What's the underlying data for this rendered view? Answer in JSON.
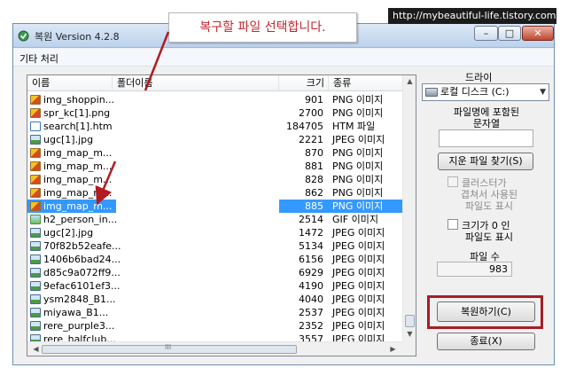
{
  "annotation": {
    "url": "http://mybeautiful-life.tistory.com",
    "callout": "복구할 파일 선택합니다."
  },
  "window": {
    "title": "복원 Version 4.2.8",
    "minimize": "–",
    "maximize": "□",
    "close": "✕"
  },
  "menu": {
    "misc": "기타 처리"
  },
  "list": {
    "headers": {
      "name": "이름",
      "folder": "폴더이름",
      "size": "크기",
      "type": "종류"
    },
    "rows": [
      {
        "name": "img_shoppin...",
        "size": "901",
        "type": "PNG 이미지",
        "icon": "png"
      },
      {
        "name": "spr_kc[1].png",
        "size": "2700",
        "type": "PNG 이미지",
        "icon": "png"
      },
      {
        "name": "search[1].htm",
        "size": "184705",
        "type": "HTM 파일",
        "icon": "htm"
      },
      {
        "name": "ugc[1].jpg",
        "size": "2221",
        "type": "JPEG 이미지",
        "icon": "jpeg"
      },
      {
        "name": "img_map_m...",
        "size": "870",
        "type": "PNG 이미지",
        "icon": "png"
      },
      {
        "name": "img_map_m...",
        "size": "881",
        "type": "PNG 이미지",
        "icon": "png"
      },
      {
        "name": "img_map_m...",
        "size": "828",
        "type": "PNG 이미지",
        "icon": "png"
      },
      {
        "name": "img_map_m...",
        "size": "862",
        "type": "PNG 이미지",
        "icon": "png"
      },
      {
        "name": "img_map_m...",
        "size": "885",
        "type": "PNG 이미지",
        "icon": "png",
        "selected": true
      },
      {
        "name": "h2_person_in...",
        "size": "2514",
        "type": "GIF 이미지",
        "icon": "gif"
      },
      {
        "name": "ugc[2].jpg",
        "size": "1472",
        "type": "JPEG 이미지",
        "icon": "jpeg"
      },
      {
        "name": "70f82b52eafe...",
        "size": "5134",
        "type": "JPEG 이미지",
        "icon": "jpeg"
      },
      {
        "name": "1406b6bad24...",
        "size": "6156",
        "type": "JPEG 이미지",
        "icon": "jpeg"
      },
      {
        "name": "d85c9a072ff9...",
        "size": "6929",
        "type": "JPEG 이미지",
        "icon": "jpeg"
      },
      {
        "name": "9efac6101ef3...",
        "size": "4190",
        "type": "JPEG 이미지",
        "icon": "jpeg"
      },
      {
        "name": "ysm2848_B1...",
        "size": "4040",
        "type": "JPEG 이미지",
        "icon": "jpeg"
      },
      {
        "name": "miyawa_B1...",
        "size": "2537",
        "type": "JPEG 이미지",
        "icon": "jpeg"
      },
      {
        "name": "rere_purple3...",
        "size": "2352",
        "type": "JPEG 이미지",
        "icon": "jpeg"
      },
      {
        "name": "rere_halfclub...",
        "size": "3557",
        "type": "JPEG 이미지",
        "icon": "jpeg"
      }
    ],
    "hscroll_grip": "III"
  },
  "panel": {
    "drive_label": "드라이",
    "drive_value": "로컬 디스크 (C:)",
    "filter_label_1": "파일명에 포함된",
    "filter_label_2": "문자열",
    "search_button": "지운 파일 찾기(S)",
    "cluster_1": "클러스터가",
    "cluster_2": "겹쳐서 사용된",
    "cluster_3": "파일도 표시",
    "zero_1": "크기가 0 인",
    "zero_2": "파일도 표시",
    "count_label": "파일 수",
    "count_value": "983",
    "restore_button": "복원하기(C)",
    "exit_button": "종료(X)"
  },
  "colors": {
    "selection": "#3399ff",
    "callout_text": "#c6262e",
    "highlight_border": "#a31f27"
  }
}
